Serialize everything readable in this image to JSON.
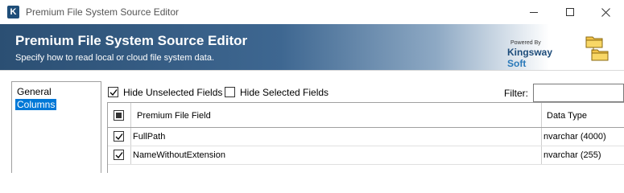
{
  "window": {
    "title": "Premium File System Source Editor",
    "app_icon": "K"
  },
  "banner": {
    "title": "Premium File System Source Editor",
    "subtitle": "Specify how to read local or cloud file system data.",
    "logo": {
      "powered_by": "Powered By",
      "brand_prefix": "Kingsway",
      "brand_suffix": "Soft"
    },
    "icon": "folders-icon"
  },
  "nav": {
    "items": [
      {
        "label": "General",
        "selected": false
      },
      {
        "label": "Columns",
        "selected": true
      }
    ]
  },
  "options": {
    "hide_unselected": {
      "label": "Hide Unselected Fields",
      "checked": true
    },
    "hide_selected": {
      "label": "Hide Selected Fields",
      "checked": false
    },
    "filter_label": "Filter:",
    "filter_value": ""
  },
  "grid": {
    "headers": {
      "field": "Premium File Field",
      "type": "Data Type"
    },
    "header_check_state": "indeterminate",
    "rows": [
      {
        "checked": true,
        "field": "FullPath",
        "type": "nvarchar (4000)"
      },
      {
        "checked": true,
        "field": "NameWithoutExtension",
        "type": "nvarchar (255)"
      }
    ]
  },
  "colors": {
    "banner": "#2b4f73",
    "selection": "#0078d7"
  }
}
